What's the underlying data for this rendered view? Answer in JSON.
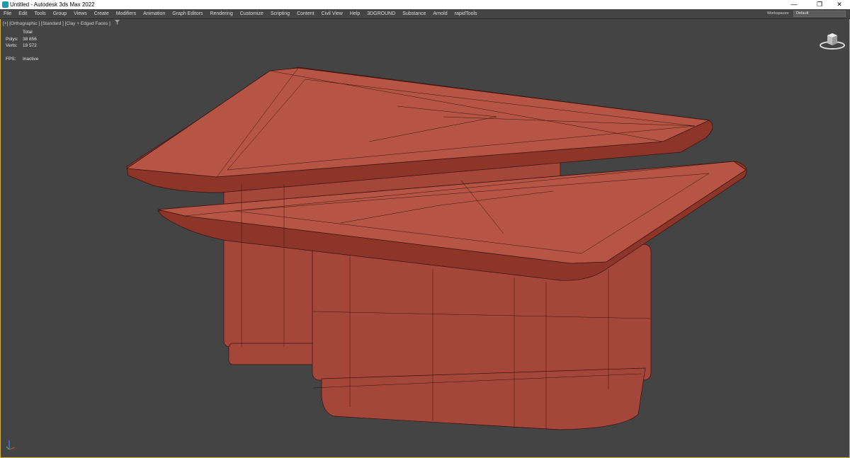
{
  "window": {
    "title": "Untitled - Autodesk 3ds Max 2022",
    "minimize_glyph": "—",
    "restore_glyph": "❐",
    "close_glyph": "✕"
  },
  "menu": {
    "items": [
      "File",
      "Edit",
      "Tools",
      "Group",
      "Views",
      "Create",
      "Modifiers",
      "Animation",
      "Graph Editors",
      "Rendering",
      "Customize",
      "Scripting",
      "Content",
      "Civil View",
      "Help",
      "3DGROUND",
      "Substance",
      "Arnold",
      "rapidTools"
    ],
    "workspaces_label": "Workspaces:",
    "workspace_value": "Default"
  },
  "viewport": {
    "label": "[+] [Orthographic ] [Standard ] [Clay + Edged Faces ]",
    "filter_icon": "funnel-icon",
    "stats": {
      "total_label": "Total",
      "polys_label": "Polys:",
      "polys_value": "38 856",
      "verts_label": "Verts:",
      "verts_value": "19 572",
      "fps_label": "FPS:",
      "fps_value": "Inactive"
    },
    "viewcube_icon": "viewcube-icon",
    "axis_icon": "axis-tripod-icon"
  },
  "colors": {
    "viewport_bg": "#444444",
    "clay_top": "#b65545",
    "clay_side": "#a4473a",
    "clay_dark": "#7a2b22",
    "wire": "#3a120d",
    "active_border": "#d4b44a"
  }
}
